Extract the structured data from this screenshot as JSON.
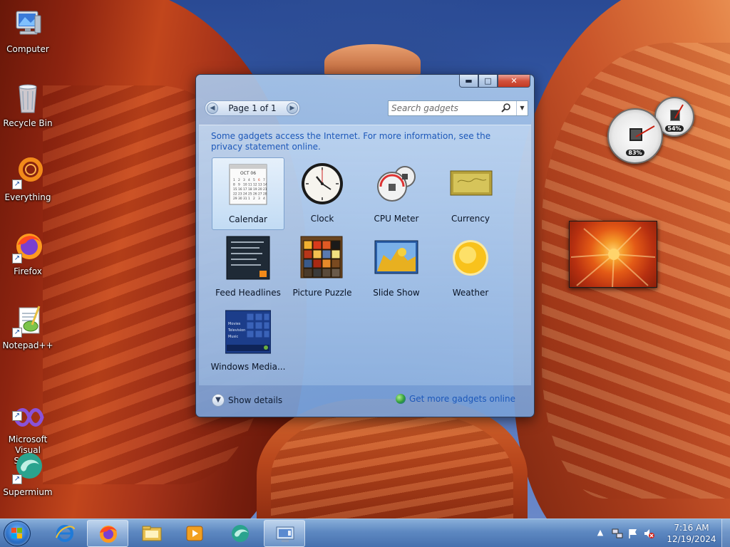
{
  "desktop_icons": [
    {
      "label": "Computer",
      "icon": "computer-icon"
    },
    {
      "label": "Recycle Bin",
      "icon": "recycle-bin-icon"
    },
    {
      "label": "Everything",
      "icon": "everything-icon"
    },
    {
      "label": "Firefox",
      "icon": "firefox-icon"
    },
    {
      "label": "Notepad++",
      "icon": "notepad-plus-plus-icon"
    },
    {
      "label": "Microsoft\nVisual Stud...",
      "icon": "visual-studio-icon"
    },
    {
      "label": "Supermium",
      "icon": "supermium-icon"
    }
  ],
  "gallery": {
    "caption": {
      "minimize": "▬",
      "maximize": "□",
      "close": "✕"
    },
    "pager": {
      "label": "Page 1 of 1",
      "prev": "◀",
      "next": "▶"
    },
    "search": {
      "placeholder": "Search gadgets"
    },
    "notice": "Some gadgets access the Internet.  For more information, see the privacy statement online.",
    "gadgets": [
      {
        "name": "Calendar",
        "icon": "calendar-icon",
        "selected": true,
        "month": "OCT 06",
        "days": [
          "1",
          "2",
          "3",
          "4",
          "5",
          "6",
          "7",
          "8",
          "9",
          "10",
          "11",
          "12",
          "13",
          "14",
          "15",
          "16",
          "17",
          "18",
          "19",
          "20",
          "21",
          "22",
          "23",
          "24",
          "25",
          "26",
          "27",
          "28",
          "29",
          "30",
          "31",
          "1",
          "2",
          "3",
          "4"
        ]
      },
      {
        "name": "Clock",
        "icon": "clock-icon"
      },
      {
        "name": "CPU Meter",
        "icon": "cpu-meter-icon"
      },
      {
        "name": "Currency",
        "icon": "currency-icon"
      },
      {
        "name": "Feed Headlines",
        "icon": "feed-headlines-icon"
      },
      {
        "name": "Picture Puzzle",
        "icon": "picture-puzzle-icon"
      },
      {
        "name": "Slide Show",
        "icon": "slide-show-icon"
      },
      {
        "name": "Weather",
        "icon": "weather-icon"
      },
      {
        "name": "Windows Media...",
        "icon": "windows-media-icon",
        "menu": [
          "Movies",
          "Television",
          "Music"
        ]
      }
    ],
    "footer": {
      "details_label": "Show details",
      "get_more_label": "Get more gadgets online"
    }
  },
  "desktop_gadgets": {
    "cpu_meter": {
      "cpu_percent": "83%",
      "memory_percent": "54%"
    }
  },
  "taskbar": {
    "pinned": [
      "internet-explorer-icon",
      "firefox-icon",
      "file-explorer-icon",
      "media-player-icon",
      "supermium-icon",
      "gadgets-icon"
    ],
    "clock": {
      "time": "7:16 AM",
      "date": "12/19/2024"
    },
    "tray_icons": [
      "show-hidden-icons-arrow",
      "network-icon",
      "action-center-flag-icon",
      "volume-muted-icon"
    ]
  },
  "colors": {
    "link": "#1d58b9",
    "taskbar": "#5582be",
    "selection": "#c4def6"
  }
}
